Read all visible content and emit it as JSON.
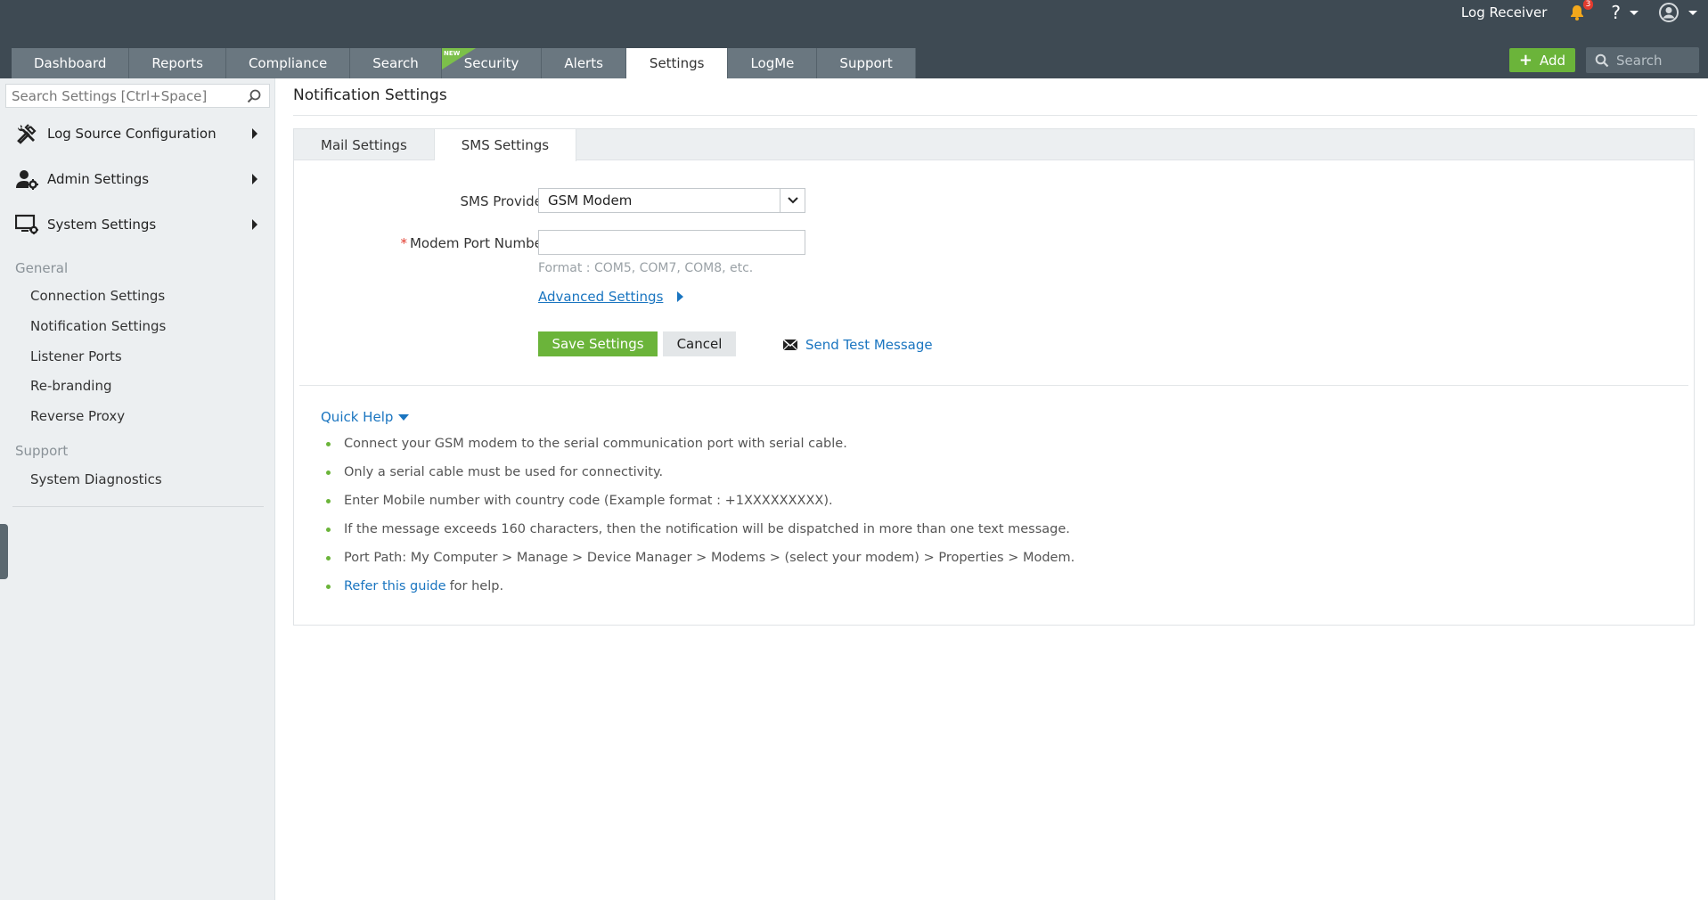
{
  "header": {
    "user_label": "Log Receiver",
    "notification_count": "3",
    "help_label": "?",
    "add_label": "Add",
    "search_placeholder": "Search",
    "new_badge": "NEW"
  },
  "nav": {
    "tabs": [
      {
        "label": "Dashboard"
      },
      {
        "label": "Reports"
      },
      {
        "label": "Compliance"
      },
      {
        "label": "Search"
      },
      {
        "label": "Security"
      },
      {
        "label": "Alerts"
      },
      {
        "label": "Settings"
      },
      {
        "label": "LogMe"
      },
      {
        "label": "Support"
      }
    ],
    "active": "Settings"
  },
  "sidebar": {
    "search_placeholder": "Search Settings [Ctrl+Space]",
    "menu": [
      {
        "label": "Log Source Configuration",
        "icon": "tools-icon"
      },
      {
        "label": "Admin Settings",
        "icon": "user-gear-icon"
      },
      {
        "label": "System Settings",
        "icon": "monitor-gear-icon"
      }
    ],
    "general_heading": "General",
    "general_items": [
      {
        "label": "Connection Settings"
      },
      {
        "label": "Notification Settings"
      },
      {
        "label": "Listener Ports"
      },
      {
        "label": "Re-branding"
      },
      {
        "label": "Reverse Proxy"
      }
    ],
    "support_heading": "Support",
    "support_items": [
      {
        "label": "System Diagnostics"
      }
    ]
  },
  "main": {
    "title": "Notification Settings",
    "subtabs": [
      {
        "label": "Mail Settings"
      },
      {
        "label": "SMS Settings"
      }
    ],
    "active_subtab": "SMS Settings",
    "form": {
      "provider_label": "SMS Provider",
      "provider_value": "GSM Modem",
      "required_mark": "*",
      "port_label": "Modem Port Number",
      "port_value": "",
      "port_hint": "Format : COM5, COM7, COM8, etc.",
      "advanced_label": "Advanced Settings",
      "save_label": "Save Settings",
      "cancel_label": "Cancel",
      "test_label": "Send Test Message"
    },
    "quick_help": {
      "title": "Quick Help",
      "items": [
        "Connect your GSM modem to the serial communication port with serial cable.",
        "Only a serial cable must be used for connectivity.",
        "Enter Mobile number with country code (Example format : +1XXXXXXXXX).",
        "If the message exceeds 160 characters, then the notification will be dispatched in more than one text message.",
        "Port Path: My Computer > Manage > Device Manager > Modems > (select your modem) > Properties > Modem."
      ],
      "guide_link": "Refer this guide",
      "guide_suffix": "for help."
    }
  },
  "colors": {
    "header_bg": "#3e4a53",
    "tab_bg": "#6a7780",
    "accent_green": "#6bb43a",
    "link_blue": "#1a75c0",
    "sidebar_bg": "#eceff1"
  }
}
